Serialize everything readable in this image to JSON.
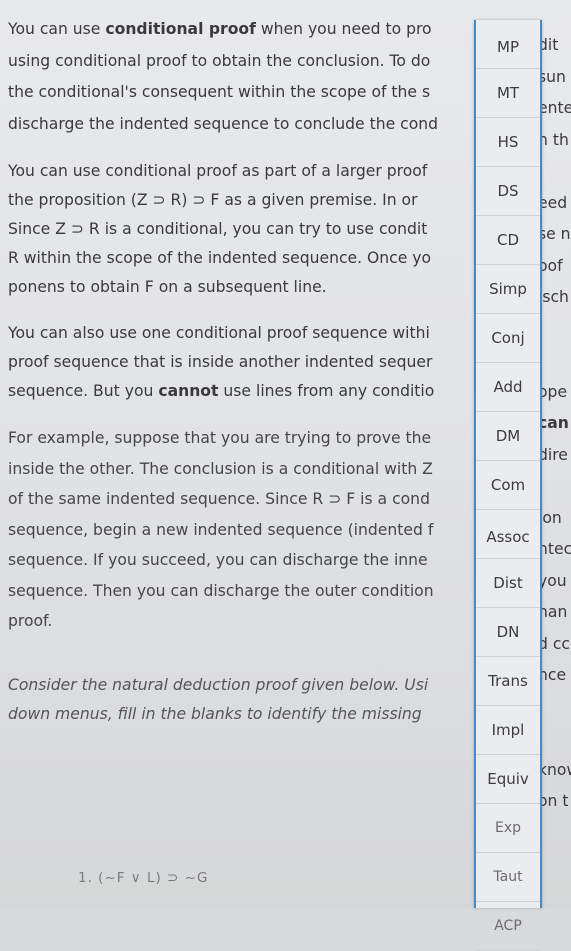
{
  "paragraphs": [
    [
      [
        "You can use ",
        "conditional proof",
        " when you need to pro"
      ],
      [
        "using conditional proof to obtain the conclusion. To do"
      ],
      [
        "the conditional's consequent within the scope of the s"
      ],
      [
        "discharge the indented sequence to conclude the cond"
      ]
    ],
    [
      [
        "You can use conditional proof as part of a larger proof"
      ],
      [
        "the proposition (Z ⊃ R) ⊃ F as a given premise. In or"
      ],
      [
        "Since Z ⊃ R is a conditional, you can try to use condit"
      ],
      [
        "R within the scope of the indented sequence. Once yo"
      ],
      [
        "ponens to obtain F on a subsequent line."
      ]
    ],
    [
      [
        "You can also use one conditional proof sequence withi"
      ],
      [
        "proof sequence that is inside another indented sequer"
      ],
      [
        "sequence. But you ",
        "cannot",
        " use lines from any conditio"
      ]
    ],
    [
      [
        "For example, suppose that you are trying to prove the"
      ],
      [
        "inside the other. The conclusion is a conditional with Z"
      ],
      [
        "of the same indented sequence. Since R ⊃ F is a cond"
      ],
      [
        "sequence, begin a new indented sequence (indented f"
      ],
      [
        "sequence. If you succeed, you can discharge the inne"
      ],
      [
        "sequence. Then you can discharge the outer condition"
      ],
      [
        "proof."
      ]
    ],
    [
      [
        "Consider the natural deduction proof given below. Usi"
      ],
      [
        "down menus, fill in the blanks to identify the missing"
      ]
    ]
  ],
  "proof_line": "1.    (~F ∨ L) ⊃ ~G",
  "right_fragments": [
    "dit",
    "sun",
    "ente",
    "n th",
    "",
    "eed",
    "se n",
    "oof",
    "isch",
    "",
    "",
    "ope",
    "can",
    "dire",
    "",
    "ion",
    "ntec",
    "you",
    "han",
    "d cc",
    "nce",
    "",
    "",
    "know",
    "on t"
  ],
  "dropdown": {
    "options": [
      "MP",
      "MT",
      "HS",
      "DS",
      "CD",
      "Simp",
      "Conj",
      "Add",
      "DM",
      "Com",
      "Assoc",
      "Dist",
      "DN",
      "Trans",
      "Impl",
      "Equiv",
      "Exp",
      "Taut",
      "ACP"
    ]
  },
  "colors": {
    "accent_border": "#3f8ccf",
    "background": "#e4e5e7",
    "text": "#3a3a3e"
  }
}
